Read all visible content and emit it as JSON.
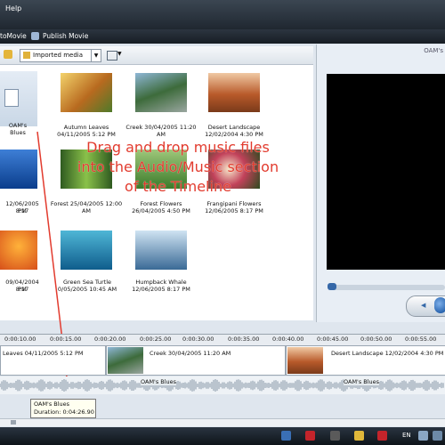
{
  "menu": {
    "help_label": "Help"
  },
  "tasks": {
    "automovie_label": "toMovie",
    "publish_label": "Publish Movie"
  },
  "toolbar": {
    "collection_label": "Imported media"
  },
  "media": [
    {
      "line1": "OAM's Blues",
      "line2": ""
    },
    {
      "line1": "Autumn Leaves",
      "line2": "04/11/2005 5:12 PM"
    },
    {
      "line1": "Creek 30/04/2005 11:20",
      "line2": "AM"
    },
    {
      "line1": "Desert Landscape",
      "line2": "12/02/2004 4:30 PM"
    },
    {
      "line1": "12/06/2005 8:17",
      "line2": "PM"
    },
    {
      "line1": "Forest 25/04/2005 12:00",
      "line2": "AM"
    },
    {
      "line1": "Forest Flowers",
      "line2": "26/04/2005 4:50 PM"
    },
    {
      "line1": "Frangipani Flowers",
      "line2": "12/06/2005 8:17 PM"
    },
    {
      "line1": "09/04/2004 8:17",
      "line2": "PM"
    },
    {
      "line1": "Green Sea Turtle",
      "line2": "0/05/2005 10:45 AM"
    },
    {
      "line1": "Humpback Whale",
      "line2": "12/06/2005 8:17 PM"
    }
  ],
  "overlay": {
    "line1": "Drag and drop music files",
    "line2": "into the Audio/Music section",
    "line3": "of the Timeline"
  },
  "preview": {
    "title": "OAM's"
  },
  "timeline": {
    "ticks": [
      "0:00:10.00",
      "0:00:15.00",
      "0:00:20.00",
      "0:00:25.00",
      "0:00:30.00",
      "0:00:35.00",
      "0:00:40.00",
      "0:00:45.00",
      "0:00:50.00",
      "0:00:55.00"
    ],
    "clips": [
      {
        "label": "Leaves 04/11/2005 5:12 PM"
      },
      {
        "label": "Creek 30/04/2005 11:20 AM"
      },
      {
        "label": "Desert Landscape 12/02/2004 4:30 PM"
      }
    ],
    "audio_labels": [
      "OAM's Blues",
      "OAM's Blues"
    ],
    "tooltip": {
      "name": "OAM's Blues",
      "duration": "Duration: 0:04:26.90"
    }
  },
  "taskbar": {
    "lang": "EN"
  }
}
